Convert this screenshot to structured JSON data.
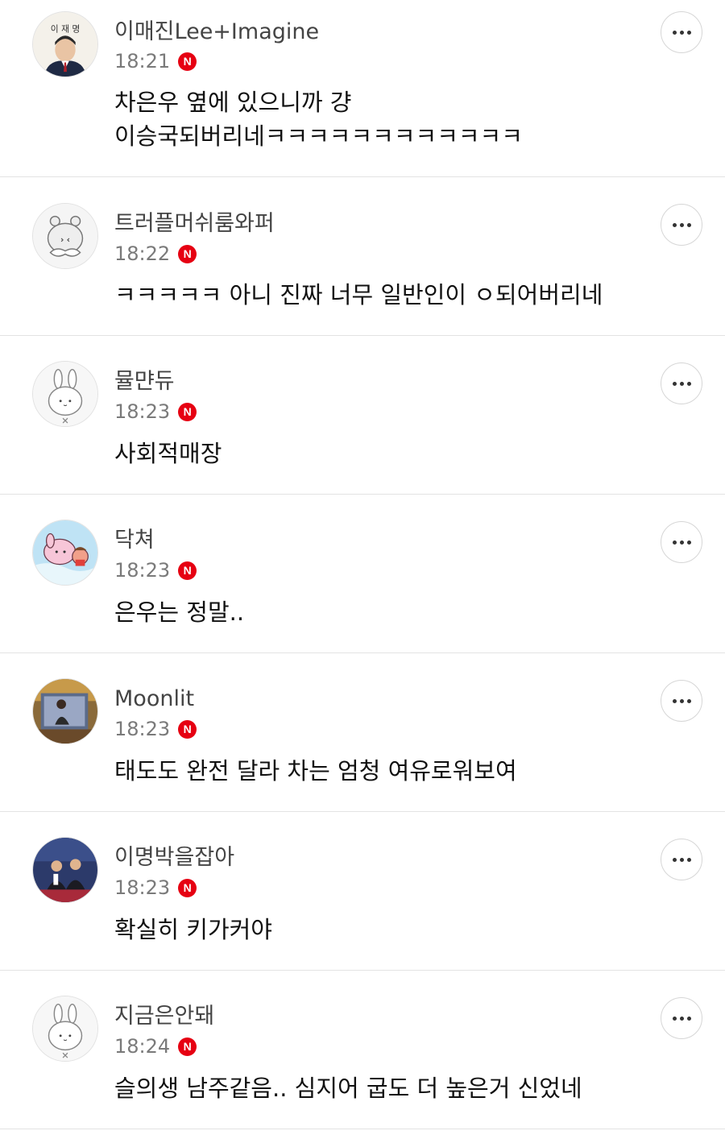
{
  "comments": [
    {
      "author": "이매진Lee+Imagine",
      "time": "18:21",
      "badge": "N",
      "text": "차은우 옆에 있으니까 걍 이승국되버리네ㅋㅋㅋㅋㅋㅋㅋㅋㅋㅋㅋㅋ",
      "avatar_caption": "이 재 명"
    },
    {
      "author": "트러플머쉬룸와퍼",
      "time": "18:22",
      "badge": "N",
      "text": "ㅋㅋㅋㅋㅋ 아니 진짜 너무 일반인이 ㅇ되어버리네"
    },
    {
      "author": "뮬먄듀",
      "time": "18:23",
      "badge": "N",
      "text": "사회적매장"
    },
    {
      "author": "닥쳐",
      "time": "18:23",
      "badge": "N",
      "text": "은우는 정말.."
    },
    {
      "author": "Moonlit",
      "time": "18:23",
      "badge": "N",
      "text": "태도도 완전 달라 차는 엄청 여유로워보여"
    },
    {
      "author": "이명박을잡아",
      "time": "18:23",
      "badge": "N",
      "text": "확실히 키가커야"
    },
    {
      "author": "지금은안돼",
      "time": "18:24",
      "badge": "N",
      "text": "슬의생 남주같음.. 심지어 굽도 더 높은거 신었네"
    }
  ],
  "colors": {
    "badge": "#e60012",
    "divider": "#e3e3e3",
    "author": "#444444",
    "time": "#7a7a7a"
  },
  "icons": {
    "more": "more-horizontal-icon",
    "badge": "naver-n-badge-icon"
  }
}
